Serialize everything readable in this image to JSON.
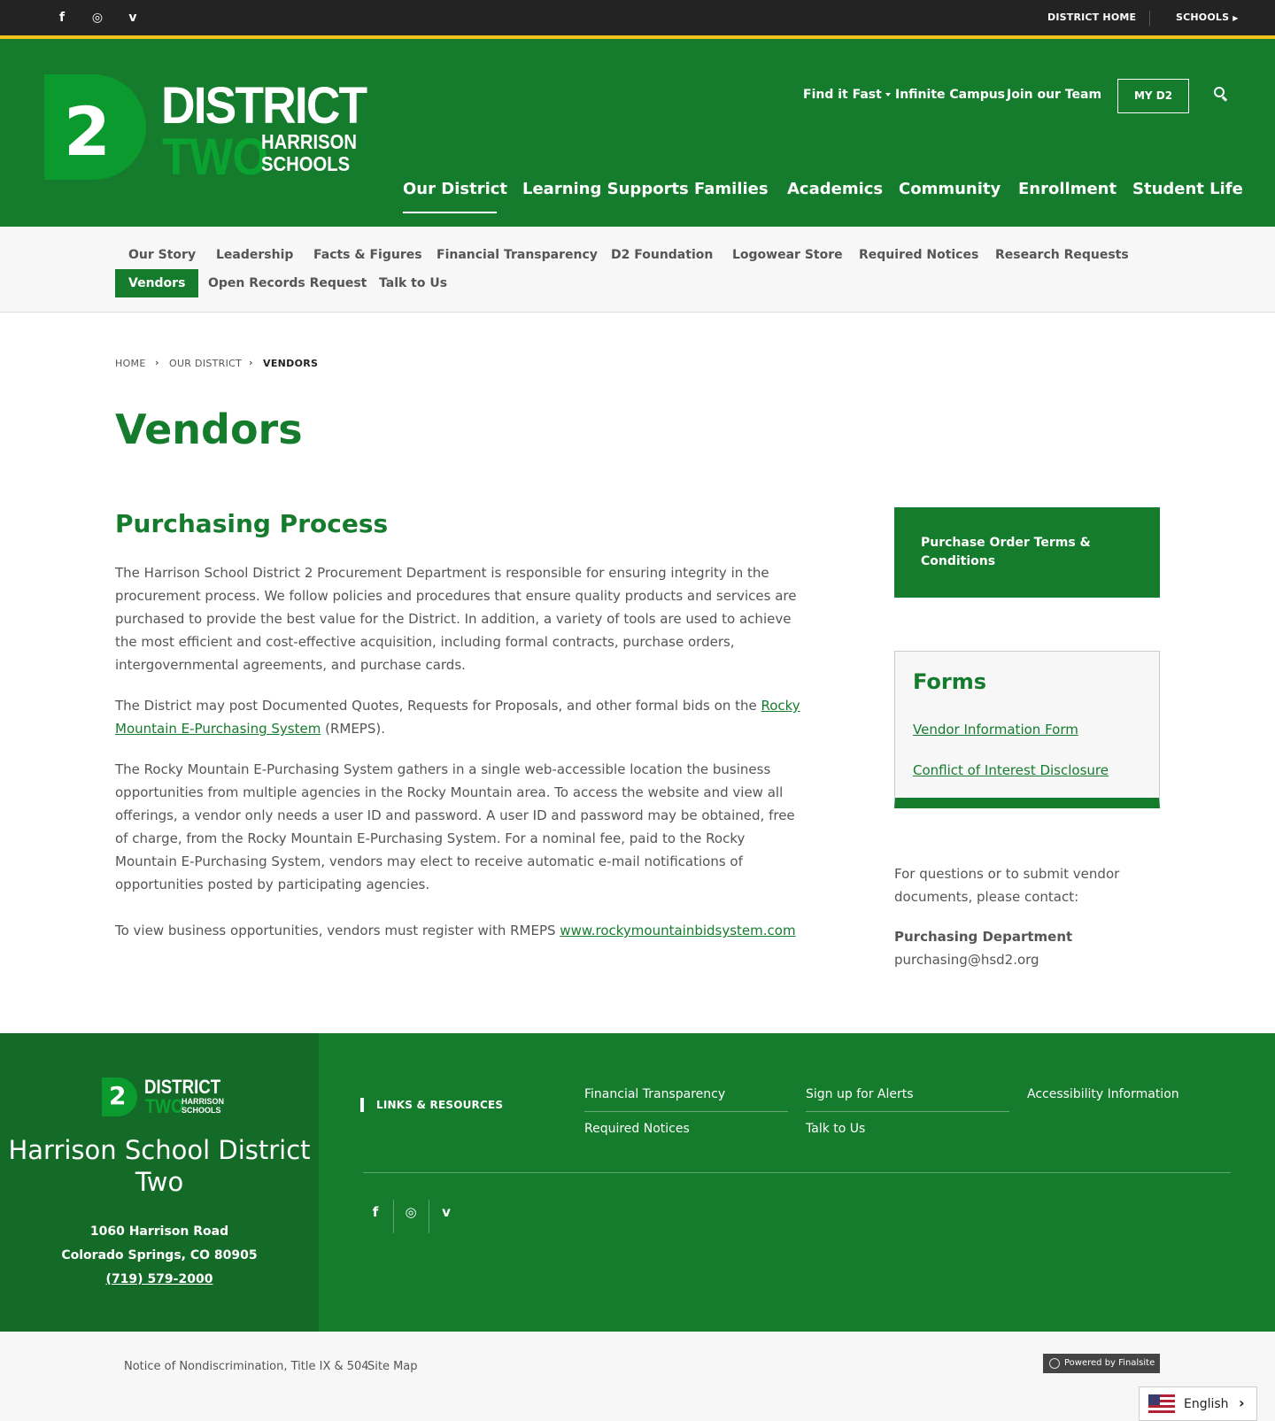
{
  "utility": {
    "social": [
      "f",
      "◎",
      "v"
    ],
    "district_home": "DISTRICT HOME",
    "schools": "SCHOOLS"
  },
  "logo": {
    "number": "2",
    "district": "DISTRICT",
    "two": "TWO",
    "harrison": "HARRISON",
    "schools": "SCHOOLS"
  },
  "header": {
    "find_it_fast": "Find it Fast",
    "infinite_campus": "Infinite Campus",
    "join_our_team": "Join our Team",
    "my_d2": "MY D2"
  },
  "main_nav": [
    "Our District",
    "Learning Supports",
    "Families",
    "Academics",
    "Community",
    "Enrollment",
    "Student Life"
  ],
  "sub_nav": {
    "row1": [
      "Our Story",
      "Leadership",
      "Facts & Figures",
      "Financial Transparency",
      "D2 Foundation",
      "Logowear Store",
      "Required Notices",
      "Research Requests"
    ],
    "row2": [
      "Vendors",
      "Open Records Request",
      "Talk to Us"
    ]
  },
  "breadcrumb": [
    "HOME",
    "OUR DISTRICT",
    "VENDORS"
  ],
  "page_title": "Vendors",
  "section_title": "Purchasing Process",
  "paragraphs": {
    "p1": "The Harrison School District 2 Procurement Department is responsible for ensuring integrity in the procurement process. We follow policies and procedures that ensure quality products and services are purchased to provide the best value for the District. In addition, a variety of tools are used to achieve the most efficient and cost-effective acquisition, including formal contracts, purchase orders, intergovernmental agreements, and purchase cards.",
    "p2_before": "The District may post Documented Quotes, Requests for Proposals, and other formal bids on the ",
    "p2_link": "Rocky Mountain E-Purchasing System",
    "p2_after": " (RMEPS).",
    "p3": "The Rocky Mountain E-Purchasing System gathers in a single web-accessible location the business opportunities from multiple agencies in the Rocky Mountain area. To access the website and view all offerings, a vendor only needs a user ID and password. A user ID and password may be obtained, free of charge, from the Rocky Mountain E-Purchasing System. For a nominal fee, paid to the Rocky Mountain E-Purchasing System, vendors may elect to receive automatic e-mail notifications of opportunities posted by participating agencies.",
    "p4_before": "To view business opportunities, vendors must register with RMEPS ",
    "p4_link": "www.rockymountainbidsystem.com"
  },
  "sidebar": {
    "po_terms": "Purchase Order Terms & Conditions",
    "forms_title": "Forms",
    "forms_links": [
      "Vendor Information Form",
      "Conflict of Interest Disclosure"
    ],
    "contact_text": "For questions or to submit vendor documents, please contact:",
    "dept": "Purchasing Department",
    "email": "purchasing@hsd2.org"
  },
  "footer": {
    "name": "Harrison School District Two",
    "address1": "1060 Harrison Road",
    "address2": "Colorado Springs, CO  80905",
    "phone": "(719) 579-2000",
    "links_title": "LINKS & RESOURCES",
    "links": [
      "Financial Transparency",
      "Sign up for Alerts",
      "Accessibility Information",
      "Required Notices",
      "Talk to Us"
    ],
    "social": [
      "f",
      "◎",
      "v"
    ]
  },
  "bottom": {
    "nondiscrimination": "Notice of Nondiscrimination, Title IX & 504",
    "site_map": "Site Map",
    "powered": "Powered by Finalsite",
    "language": "English",
    "lang_arrow": "›"
  }
}
